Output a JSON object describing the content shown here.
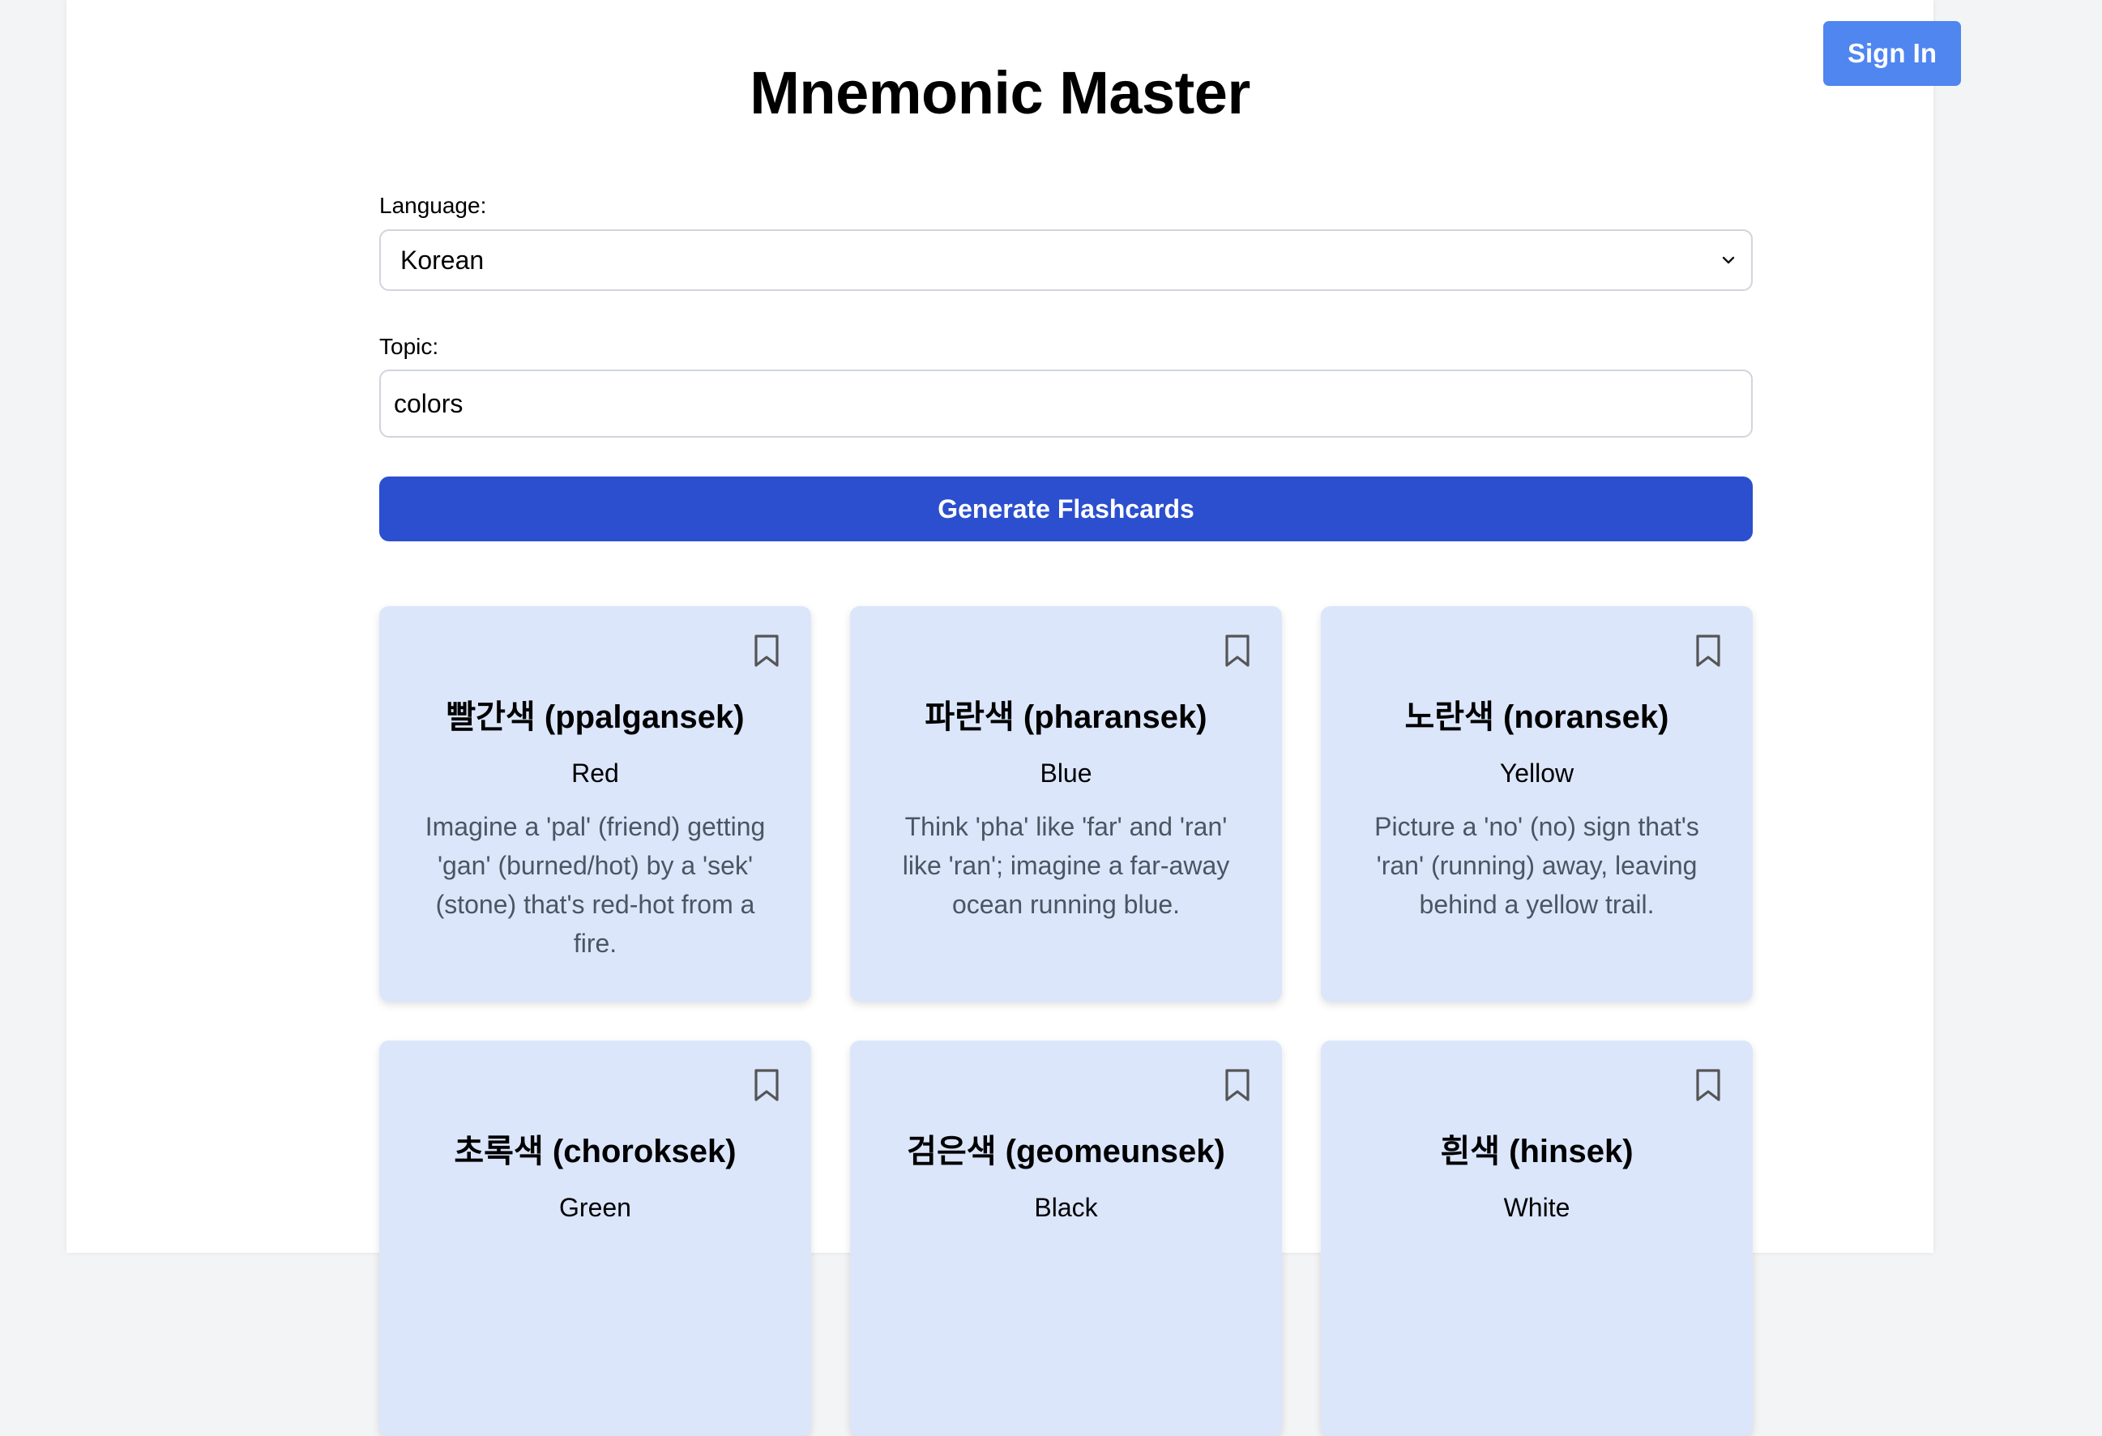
{
  "app": {
    "title": "Mnemonic Master",
    "signin_label": "Sign In"
  },
  "form": {
    "language_label": "Language:",
    "language_value": "Korean",
    "topic_label": "Topic:",
    "topic_value": "colors",
    "generate_label": "Generate Flashcards"
  },
  "cards": [
    {
      "word": "빨간색 (ppalgansek)",
      "meaning": "Red",
      "mnemonic": "Imagine a 'pal' (friend) getting 'gan' (burned/hot) by a 'sek' (stone) that's red-hot from a fire."
    },
    {
      "word": "파란색 (pharansek)",
      "meaning": "Blue",
      "mnemonic": "Think 'pha' like 'far' and 'ran' like 'ran'; imagine a far-away ocean running blue."
    },
    {
      "word": "노란색 (noransek)",
      "meaning": "Yellow",
      "mnemonic": "Picture a 'no' (no) sign that's 'ran' (running) away, leaving behind a yellow trail."
    },
    {
      "word": "초록색 (choroksek)",
      "meaning": "Green",
      "mnemonic": ""
    },
    {
      "word": "검은색 (geomeunsek)",
      "meaning": "Black",
      "mnemonic": ""
    },
    {
      "word": "흰색 (hinsek)",
      "meaning": "White",
      "mnemonic": ""
    }
  ],
  "icons": {
    "bookmark": "bookmark-icon",
    "chevron": "chevron-down-icon"
  },
  "colors": {
    "background": "#f3f4f6",
    "signin_button": "#4f86f0",
    "generate_button": "#2b4fce",
    "card_background": "#dbe6fb",
    "mnemonic_text": "#4b5563"
  }
}
